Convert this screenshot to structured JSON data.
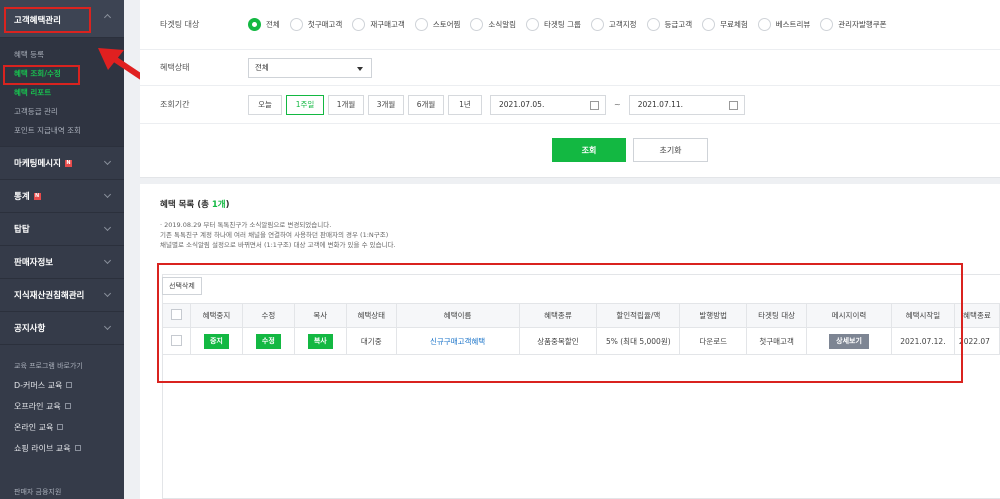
{
  "sidebar": {
    "top_section": "고객혜택관리",
    "sub_items": [
      "혜택 등록",
      "혜택 조회/수정",
      "혜택 리포트",
      "고객등급 관리",
      "포인트 지급내역 조회"
    ],
    "sections": [
      {
        "label": "마케팅메시지",
        "new": true
      },
      {
        "label": "통계",
        "new": true
      },
      {
        "label": "탑탑",
        "new": false
      },
      {
        "label": "판매자정보",
        "new": false
      },
      {
        "label": "지식재산권침해관리",
        "new": false
      },
      {
        "label": "공지사항",
        "new": false
      }
    ],
    "edu_title": "교육 프로그램 바로가기",
    "edu_items": [
      "D-커머스 교육",
      "오프라인 교육",
      "온라인 교육",
      "쇼핑 라이브 교육"
    ],
    "bottom": "판매자 금융지원"
  },
  "filter": {
    "target_label": "타겟팅 대상",
    "target_options": [
      "전체",
      "첫구매고객",
      "재구매고객",
      "스토어찜",
      "소식알림",
      "타겟팅 그룹",
      "고객지정",
      "등급고객",
      "무료체험",
      "베스트리뷰",
      "관리자발행쿠폰"
    ],
    "status_label": "혜택상태",
    "status_value": "전체",
    "period_label": "조회기간",
    "period_options": [
      "오늘",
      "1주일",
      "1개월",
      "3개월",
      "6개월",
      "1년"
    ],
    "date_from": "2021.07.05.",
    "date_to": "2021.07.11.",
    "tilde": "~",
    "search_label": "조회",
    "reset_label": "초기화"
  },
  "list": {
    "title_prefix": "혜택 목록 (총 ",
    "count": "1개",
    "title_suffix": ")",
    "notice": [
      "· 2019.08.29 부터 톡톡친구가 소식알림으로 변경되었습니다.",
      "기존 톡톡친구 계정 하나에 여러 채널을 연결하여 사용하던 판매자의 경우 (1:N구조)",
      "채널별로 소식알림 설정으로 바뀌면서 (1:1구조) 대상 고객에 변화가 있을 수 있습니다."
    ],
    "delete_label": "선택삭제",
    "columns": [
      "",
      "혜택중지",
      "수정",
      "복사",
      "혜택상태",
      "혜택이름",
      "혜택종류",
      "할인적립율/액",
      "발행방법",
      "타겟팅 대상",
      "메시지이력",
      "혜택시작일",
      "혜택종료"
    ],
    "row": {
      "stop": "중지",
      "edit": "수정",
      "copy": "복사",
      "status": "대기중",
      "name": "신규구매고객혜택",
      "type": "상품중복할인",
      "rate": "5% (최대 5,000원)",
      "method": "다운로드",
      "target": "첫구매고객",
      "message": "상세보기",
      "start": "2021.07.12.",
      "end": "2022.07"
    }
  },
  "colors": {
    "accent": "#13b842",
    "highlight": "#d9231f",
    "sidebar": "#353b49"
  }
}
